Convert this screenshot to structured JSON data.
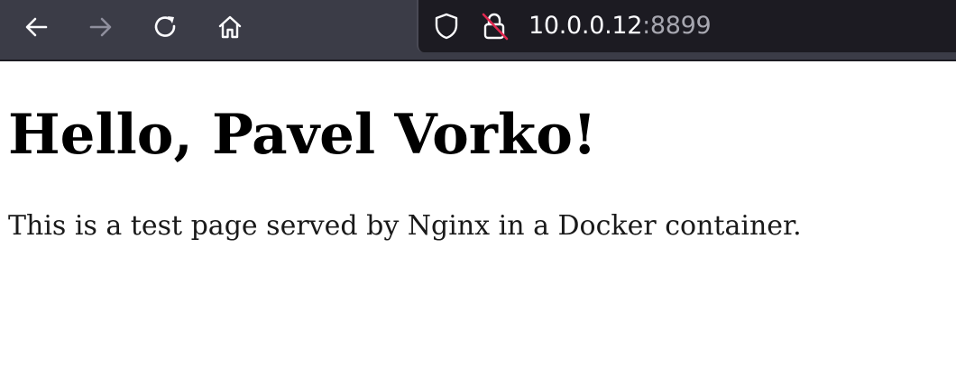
{
  "browser": {
    "back_icon": "arrow-left-icon",
    "forward_icon": "arrow-right-icon",
    "reload_icon": "reload-icon",
    "home_icon": "home-icon",
    "tracking_icon": "shield-icon",
    "insecure_icon": "lock-strike-icon",
    "url_host": "10.0.0.12",
    "url_port": ":8899",
    "colors": {
      "toolbar": "#3b3c47",
      "urlbar": "#1c1b22",
      "insecure_strike": "#e22850"
    }
  },
  "page": {
    "heading": "Hello, Pavel Vorko!",
    "paragraph": "This is a test page served by Nginx in a Docker container."
  }
}
